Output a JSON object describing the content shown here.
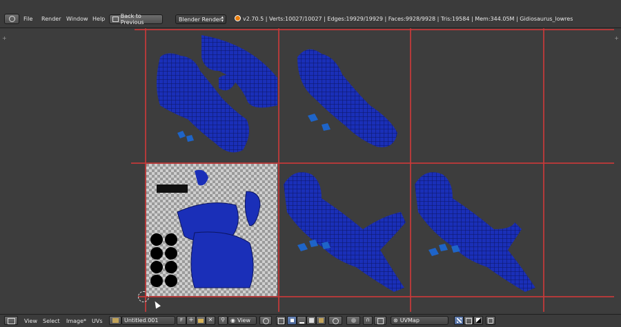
{
  "topbar": {
    "editor_type_icon": "info-icon",
    "menus": [
      "File",
      "Render",
      "Window",
      "Help"
    ],
    "back_button": "Back to Previous",
    "render_engine": "Blender Render",
    "stats": "v2.70.5 | Verts:10027/10027 | Edges:19929/19929 | Faces:9928/9928 | Tris:19584 | Mem:344.05M | Gidiosaurus_lowres"
  },
  "bottombar": {
    "editor_type_icon": "uv-image-editor-icon",
    "menus": [
      "View",
      "Select",
      "Image*",
      "UVs"
    ],
    "image_name": "Untitled.001",
    "fake_user": "F",
    "view_mode": "View",
    "uv_map": "UVMap"
  },
  "colors": {
    "grid_line": "#c83a3a",
    "uv_fill": "#1a2fb8",
    "uv_dark": "#0c1560",
    "background": "#3d3d3d",
    "checker_light": "#cfcfcf",
    "checker_dark": "#9a9a9a"
  }
}
